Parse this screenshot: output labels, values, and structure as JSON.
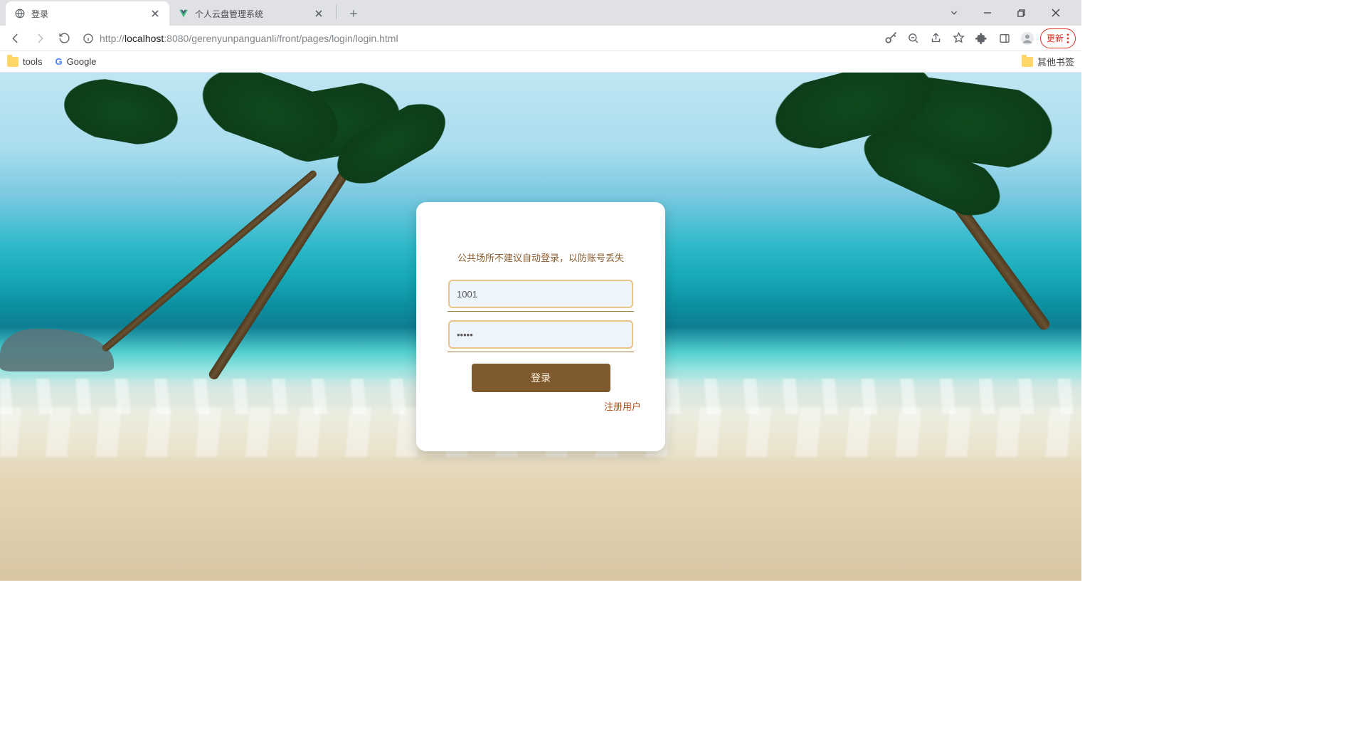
{
  "browser": {
    "tabs": [
      {
        "title": "登录",
        "active": true
      },
      {
        "title": "个人云盘管理系统",
        "active": false
      }
    ],
    "url_prefix": "http://",
    "url_host": "localhost",
    "url_port": ":8080",
    "url_path": "/gerenyunpanguanli/front/pages/login/login.html",
    "update_label": "更新",
    "bookmarks": {
      "items": [
        {
          "label": "tools",
          "icon": "folder"
        },
        {
          "label": "Google",
          "icon": "google"
        }
      ],
      "other_label": "其他书签"
    }
  },
  "login": {
    "hint": "公共场所不建议自动登录，以防账号丢失",
    "username_value": "1001",
    "password_value": "•••••",
    "submit_label": "登录",
    "register_label": "注册用户"
  },
  "colors": {
    "accent_brown": "#805a2f",
    "link_orange": "#b24a18"
  }
}
